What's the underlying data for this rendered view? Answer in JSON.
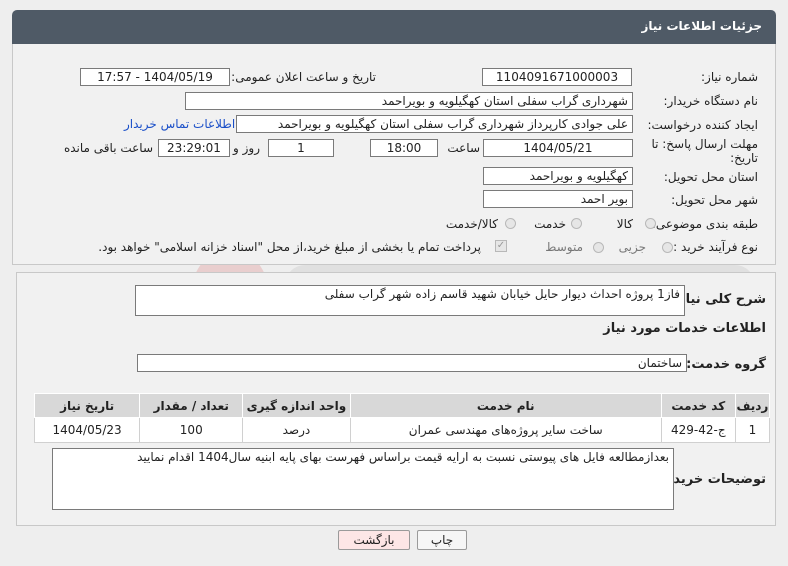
{
  "header": {
    "title": "جزئیات اطلاعات نیاز"
  },
  "form": {
    "need_number_label": "شماره نیاز:",
    "need_number": "1104091671000003",
    "announce_label": "تاریخ و ساعت اعلان عمومی:",
    "announce_value": "1404/05/19 - 17:57",
    "buyer_org_label": "نام دستگاه خریدار:",
    "buyer_org": "شهرداری گراب سفلی استان کهگیلویه و بویراحمد",
    "creator_label": "ایجاد کننده درخواست:",
    "creator": "علی جوادی کارپرداز شهرداری گراب سفلی استان کهگیلویه و بویراحمد",
    "contact_link": "اطلاعات تماس خریدار",
    "deadline_label_line1": "مهلت ارسال پاسخ: تا",
    "deadline_label_line2": "تاریخ:",
    "deadline_date": "1404/05/21",
    "time_label": "ساعت",
    "deadline_time": "18:00",
    "days_value": "1",
    "days_label": "روز و",
    "remaining_time": "23:29:01",
    "remaining_label": "ساعت باقی مانده",
    "province_label": "استان محل تحویل:",
    "province": "کهگیلویه و بویراحمد",
    "city_label": "شهر محل تحویل:",
    "city": "بویر احمد",
    "category_label": "طبقه بندی موضوعی:",
    "category_options": [
      "کالا",
      "خدمت",
      "کالا/خدمت"
    ],
    "process_label": "نوع فرآیند خرید :",
    "process_options": [
      "جزیی",
      "متوسط"
    ],
    "payment_note": "پرداخت تمام یا بخشی از مبلغ خرید،از محل \"اسناد خزانه اسلامی\" خواهد بود."
  },
  "details": {
    "description_label": "شرح کلی نیاز:",
    "description": "فاز1 پروژه احداث دیوار حایل خیابان شهید قاسم زاده شهر گراب سفلی",
    "services_heading": "اطلاعات خدمات مورد نیاز",
    "service_group_label": "گروه خدمت:",
    "service_group": "ساختمان",
    "table": {
      "headers": [
        "ردیف",
        "کد خدمت",
        "نام خدمت",
        "واحد اندازه گیری",
        "تعداد / مقدار",
        "تاریخ نیاز"
      ],
      "rows": [
        [
          "1",
          "ج-42-429",
          "ساخت سایر پروژه‌های مهندسی عمران",
          "درصد",
          "100",
          "1404/05/23"
        ]
      ]
    },
    "buyer_notes_label": "توضیحات خریدار:",
    "buyer_notes": "بعدازمطالعه فایل های پیوستی نسبت به ارایه قیمت براساس فهرست بهای پایه ابنیه سال1404 اقدام نمایید"
  },
  "buttons": {
    "print": "چاپ",
    "back": "بازگشت"
  },
  "colors": {
    "header_bg": "#4f5a66",
    "link": "#1a4fc8",
    "back_button_bg": "#fde6e6"
  }
}
